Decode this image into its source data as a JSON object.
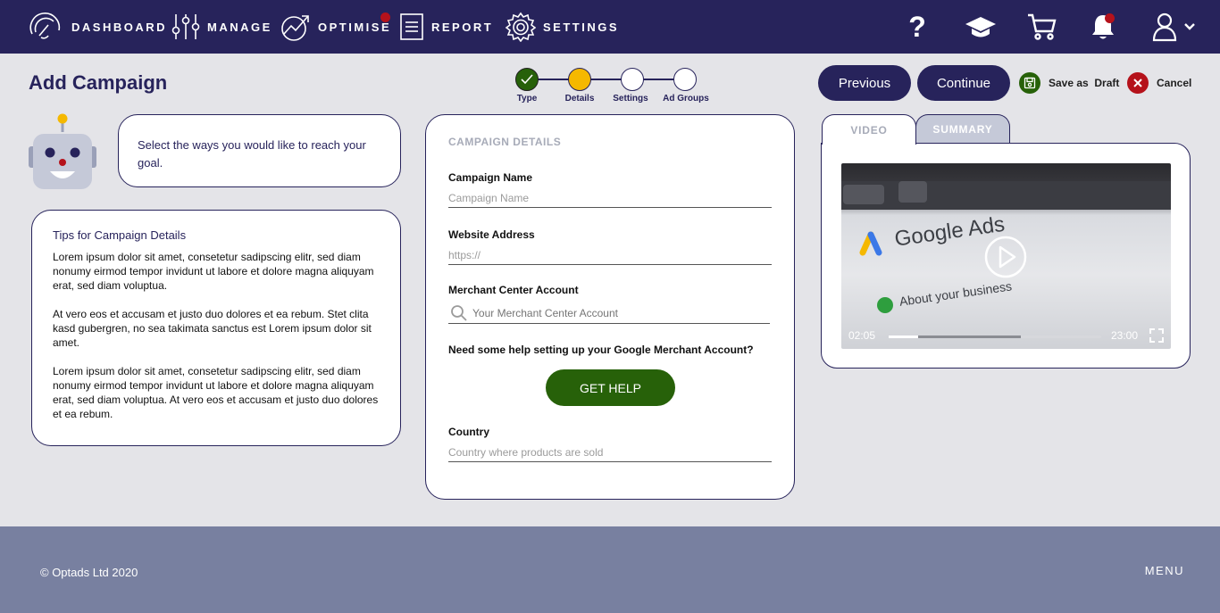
{
  "nav": {
    "items": [
      {
        "label": "DASHBOARD",
        "icon": "gauge-icon"
      },
      {
        "label": "MANAGE",
        "icon": "sliders-icon"
      },
      {
        "label": "OPTIMISE",
        "icon": "chart-arrow-icon"
      },
      {
        "label": "REPORT",
        "icon": "document-icon"
      },
      {
        "label": "SETTINGS",
        "icon": "gear-icon"
      }
    ],
    "help_label": "?",
    "icons": [
      "help-icon",
      "learning-cap-icon",
      "cart-icon",
      "bell-icon",
      "user-icon",
      "chevron-down-icon"
    ],
    "alert_color": "#b5121b"
  },
  "page": {
    "title": "Add Campaign"
  },
  "stepper": {
    "steps": [
      {
        "label": "Type",
        "state": "done"
      },
      {
        "label": "Details",
        "state": "current"
      },
      {
        "label": "Settings",
        "state": "todo"
      },
      {
        "label": "Ad Groups",
        "state": "todo"
      }
    ],
    "done_color": "#276109",
    "current_color": "#f5b800"
  },
  "actions": {
    "previous": "Previous",
    "continue": "Continue",
    "save_draft": "Save as  Draft",
    "cancel": "Cancel"
  },
  "assistant": {
    "message": "Select the ways you would like to reach your goal."
  },
  "tips": {
    "title": "Tips for Campaign Details",
    "paragraphs": [
      "Lorem ipsum dolor sit amet, consetetur sadipscing elitr, sed diam nonumy eirmod tempor invidunt ut labore et dolore magna aliquyam erat, sed diam voluptua.",
      "At vero eos et accusam et justo duo dolores et ea rebum. Stet clita kasd gubergren, no sea takimata sanctus est Lorem ipsum dolor sit amet.",
      "Lorem ipsum dolor sit amet, consetetur sadipscing elitr, sed diam nonumy eirmod tempor invidunt ut labore et dolore magna aliquyam erat, sed diam voluptua. At vero eos et accusam et justo duo dolores et ea rebum."
    ]
  },
  "form": {
    "section_title": "CAMPAIGN DETAILS",
    "campaign_name": {
      "label": "Campaign Name",
      "placeholder": "Campaign Name"
    },
    "website": {
      "label": "Website Address",
      "placeholder": "https://"
    },
    "merchant": {
      "label": "Merchant Center Account",
      "placeholder": "Your Merchant Center Account"
    },
    "help_question": "Need some help setting up your Google Merchant Account?",
    "help_button": "GET HELP",
    "country": {
      "label": "Country",
      "placeholder": "Country where products are sold"
    }
  },
  "media": {
    "tabs": [
      "VIDEO",
      "SUMMARY"
    ],
    "active_tab": "VIDEO",
    "screen_brand": "Google Ads",
    "screen_text": "About your business",
    "current_time": "02:05",
    "total_time": "23:00",
    "progress": 0.14,
    "buffered": 0.62
  },
  "footer": {
    "copyright": "© Optads Ltd 2020",
    "menu": "MENU"
  }
}
